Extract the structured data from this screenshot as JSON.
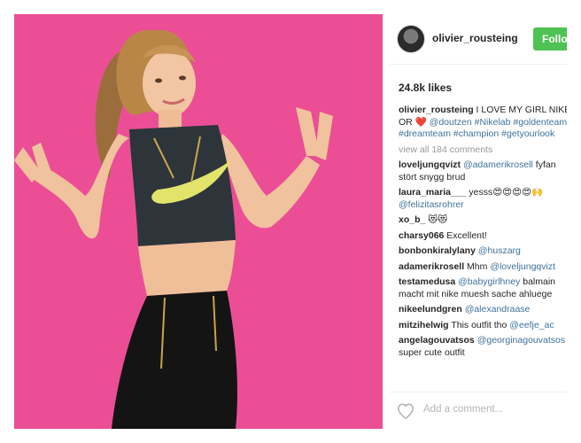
{
  "post": {
    "username": "olivier_rousteing",
    "follow_label": "Follow",
    "likes": "24.8k likes",
    "caption": {
      "user": "olivier_rousteing",
      "line1": "I LOVE MY GIRL NIKE",
      "line2_pre": "OR",
      "heart": "❤️",
      "line2_tags": "@doutzen #Nikelab #goldenteam",
      "line3": "#dreamteam #champion #getyourlook"
    },
    "view_all": "view all 184 comments",
    "comments": [
      {
        "user": "loveljungqvizt",
        "mention": "@adamerikrosell",
        "text": " fyfan",
        "line2": "stört snygg brud"
      },
      {
        "user": "laura_maria___",
        "text": " yesss😍😍😍😍🙌",
        "line2_mention": "@felizitasrohrer"
      },
      {
        "user": "xo_b_",
        "text": " 😻😻"
      },
      {
        "user": "charsy066",
        "text": " Excellent!"
      },
      {
        "user": "bonbonkiralylany",
        "mention": "@huszarg"
      },
      {
        "user": "adamerikrosell",
        "text": " Mhm ",
        "mention": "@loveljungqvizt"
      },
      {
        "user": "testamedusa",
        "mention": "@babygirlhney",
        "text": " balmain",
        "line2": "macht mit nike muesh sache ahluege"
      },
      {
        "user": "nikeelundgren",
        "mention": "@alexandraase"
      },
      {
        "user": "mitzihelwig",
        "text": " This outfit tho ",
        "mention": "@eefje_ac"
      },
      {
        "user": "angelagouvatsos",
        "mention": "@georginagouvatsos",
        "line2": "super cute outfit"
      }
    ],
    "add_comment_placeholder": "Add a comment..."
  },
  "colors": {
    "photo_background": "#ea4a93",
    "follow_button": "#4ec253",
    "link": "#3f729b"
  },
  "icons": {
    "avatar": "avatar",
    "like": "heart-icon"
  }
}
